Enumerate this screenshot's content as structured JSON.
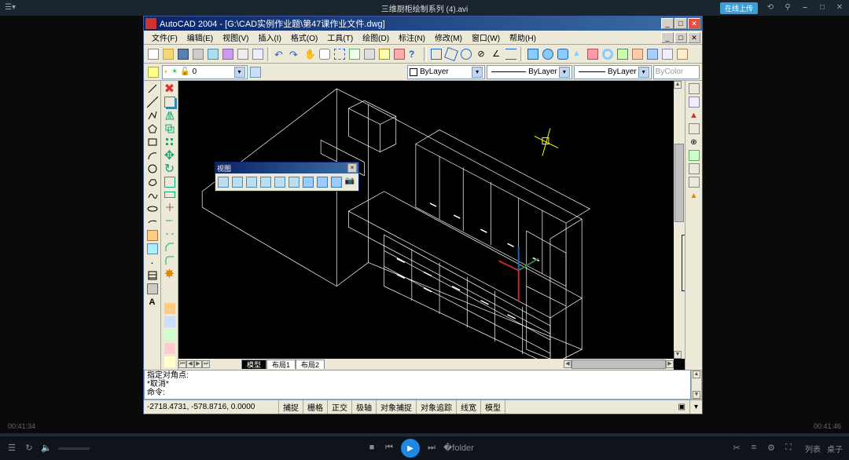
{
  "player": {
    "video_title": "三维厨柜绘制系列 (4).avi",
    "badge": "在线上传",
    "time_current": "00:41:34",
    "time_total": "00:41:46",
    "bottom_left_label1": "列表",
    "bottom_left_label2": "桌子"
  },
  "cad": {
    "title": "AutoCAD 2004 - [G:\\CAD实例作业题\\第47课作业文件.dwg]",
    "menubar": [
      "文件(F)",
      "编辑(E)",
      "视图(V)",
      "插入(I)",
      "格式(O)",
      "工具(T)",
      "绘图(D)",
      "标注(N)",
      "修改(M)",
      "窗口(W)",
      "帮助(H)"
    ],
    "layer_combo": "0",
    "prop_combo1": "ByLayer",
    "prop_combo2": "ByLayer",
    "prop_combo3": "ByLayer",
    "prop_combo4": "ByColor",
    "float_title": "视图",
    "tabs": [
      "模型",
      "布局1",
      "布局2"
    ],
    "active_tab": 0,
    "cmd": {
      "line1": "指定对角点:",
      "line2": "*取消*",
      "prompt": "命令:"
    },
    "status": {
      "coords": "-2718.4731, -578.8716, 0.0000",
      "buttons": [
        "捕捉",
        "栅格",
        "正交",
        "极轴",
        "对象捕捉",
        "对象追踪",
        "线宽",
        "模型"
      ]
    }
  }
}
